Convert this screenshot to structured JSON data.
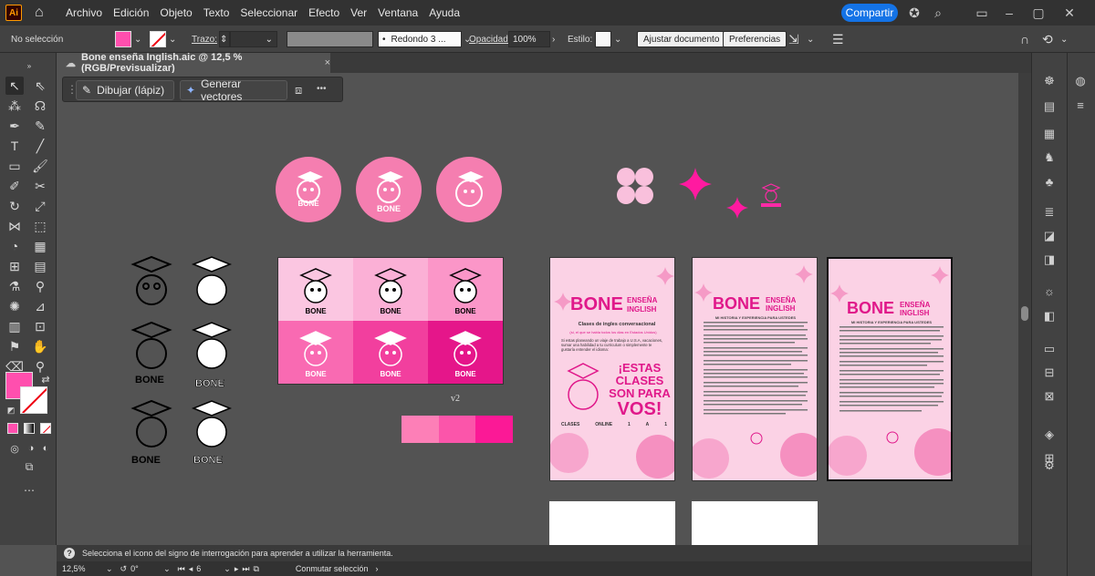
{
  "app": {
    "logo": "Ai"
  },
  "menu": [
    "Archivo",
    "Edición",
    "Objeto",
    "Texto",
    "Seleccionar",
    "Efecto",
    "Ver",
    "Ventana",
    "Ayuda"
  ],
  "share_label": "Compartir",
  "control": {
    "selection": "No selección",
    "trazo_label": "Trazo:",
    "brush_label": "Redondo 3 ...",
    "opacity_label": "Opacidad:",
    "opacity_value": "100%",
    "style_label": "Estilo:",
    "adjust_button": "Ajustar documento",
    "prefs_button": "Preferencias",
    "fill_color": "#ff4fae",
    "stroke_none": true
  },
  "document_tab": {
    "title": "Bone enseña Inglish.aic @ 12,5 % (RGB/Previsualizar)",
    "close": "×"
  },
  "contextual": {
    "draw_label": "Dibujar (lápiz)",
    "vector_label": "Generar vectores",
    "more": "•••"
  },
  "artwork": {
    "v2_label": "v2",
    "swatches": [
      "#fd7fb7",
      "#fb55aa",
      "#fb1996"
    ],
    "grid_colors": [
      "#fbc6e1",
      "#fbb0d6",
      "#fb96c8",
      "#f96ab2",
      "#f23f9e",
      "#e5168a"
    ],
    "logo_text": "BONE",
    "poster1": {
      "bone": "BONE",
      "ensena": "ENSEÑA",
      "inglish": "INGLISH",
      "subtitle": "Clases de ingles conversacional",
      "subtitle2": "(si, el que se habla todos los dias en Estados Unidos)",
      "body": "Si estas planeando un viaje de trabajo a U.S.A, vacaciones, sumar una habilidad a tu curriculum o simplemente te gustaría entender el idioma:",
      "big": [
        "¡ESTAS",
        "CLASES",
        "SON PARA",
        "VOS!"
      ],
      "footer": [
        "CLASES",
        "ONLINE",
        "1",
        "A",
        "1"
      ]
    },
    "poster2": {
      "bone": "BONE",
      "ensena": "ENSEÑA",
      "inglish": "INGLISH",
      "subtitle": "MI HISTORIA Y EXPERIENCIA PARA USTEDES"
    },
    "poster3": {
      "bone": "BONE",
      "ensena": "ENSEÑA",
      "inglish": "INGLISH",
      "subtitle": "MI HISTORIA Y EXPERIENCIA PARA USTEDES"
    }
  },
  "hint": "Selecciona el icono del signo de interrogación para aprender a utilizar la herramienta.",
  "status": {
    "zoom": "12,5%",
    "rotation": "0°",
    "artboard": "6",
    "mode": "Conmutar selección"
  }
}
